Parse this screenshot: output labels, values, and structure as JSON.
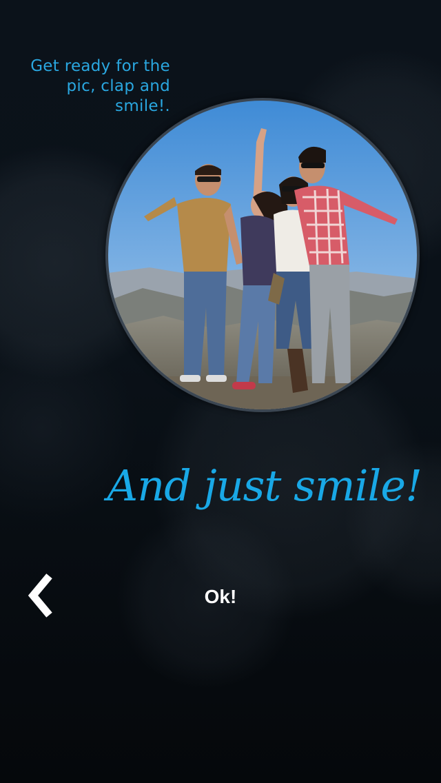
{
  "intro": {
    "hint_lines": [
      "Get ready for the",
      "pic, clap and",
      "smile!."
    ],
    "headline": "And just smile!",
    "photo": {
      "kind": "group photo of four friends posing outdoors on a hilltop",
      "shape": "circle"
    },
    "nav": {
      "back_icon": "chevron-left-icon",
      "ok_label": "Ok!"
    }
  },
  "colors": {
    "accent": "#1aa8e4",
    "background": "#070b10",
    "button_text": "#ffffff"
  }
}
